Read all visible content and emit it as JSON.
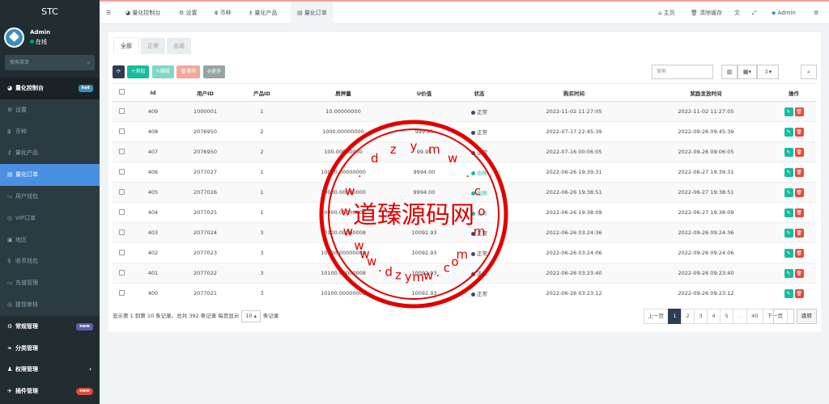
{
  "brand": "STC",
  "user": {
    "name": "Admin",
    "status": "在线"
  },
  "sidebar": {
    "search_placeholder": "搜索菜单",
    "items": [
      {
        "label": "量化控制台",
        "icon": "dashboard-icon",
        "badge": "hot",
        "kind": "head"
      },
      {
        "label": "设置",
        "icon": "gear-icon",
        "kind": "sub"
      },
      {
        "label": "币种",
        "icon": "bitcoin-icon",
        "kind": "sub"
      },
      {
        "label": "量化产品",
        "icon": "key-icon",
        "kind": "sub"
      },
      {
        "label": "量化订单",
        "icon": "book-icon",
        "kind": "active"
      },
      {
        "label": "用户钱包",
        "icon": "wallet-icon",
        "kind": "sub"
      },
      {
        "label": "VIP订单",
        "icon": "vip-icon",
        "kind": "sub"
      },
      {
        "label": "地区",
        "icon": "map-icon",
        "kind": "sub"
      },
      {
        "label": "收币钱包",
        "icon": "dollar-icon",
        "kind": "sub"
      },
      {
        "label": "充值管理",
        "icon": "card-icon",
        "kind": "sub"
      },
      {
        "label": "提现审核",
        "icon": "circle-icon",
        "kind": "sub"
      },
      {
        "label": "常规管理",
        "icon": "cogs-icon",
        "badge": "new",
        "kind": "grp"
      },
      {
        "label": "分类管理",
        "icon": "leaf-icon",
        "kind": "grp"
      },
      {
        "label": "权限管理",
        "icon": "group-icon",
        "chevron": "‹",
        "kind": "grp"
      },
      {
        "label": "插件管理",
        "icon": "rocket-icon",
        "badge": "new",
        "kind": "grp"
      }
    ]
  },
  "header": {
    "tabs": [
      "量化控制台",
      "设置",
      "币种",
      "量化产品",
      "量化订单"
    ],
    "right": {
      "home": "主页",
      "clear": "清除缓存",
      "admin": "Admin"
    }
  },
  "filter_tabs": [
    "全部",
    "正常",
    "出局"
  ],
  "toolbar": {
    "refresh": "⟳",
    "add": "添加",
    "edit": "编辑",
    "delete": "删除",
    "more": "更多"
  },
  "search_placeholder": "搜索",
  "columns": [
    "",
    "Id",
    "用户ID",
    "产品ID",
    "质押量",
    "U价值",
    "状态",
    "购买时间",
    "奖励发放时间",
    "操作"
  ],
  "rows": [
    {
      "id": "409",
      "uid": "1000001",
      "pid": "1",
      "amount": "10.00000000",
      "uvalue": "",
      "status": "正常",
      "buy": "2022-11-02 11:27:05",
      "reward": "2022-11-02 11:27:05"
    },
    {
      "id": "408",
      "uid": "2076950",
      "pid": "2",
      "amount": "1000.00000000",
      "uvalue": "999.95",
      "status": "正常",
      "buy": "2022-07-17 22:45:39",
      "reward": "2022-09-26 09:45:39"
    },
    {
      "id": "407",
      "uid": "2076950",
      "pid": "2",
      "amount": "100.00000000",
      "uvalue": "99.95",
      "status": "正常",
      "buy": "2022-07-16 00:06:05",
      "reward": "2022-09-26 09:06:05"
    },
    {
      "id": "406",
      "uid": "2077027",
      "pid": "1",
      "amount": "10000.00000000",
      "uvalue": "9994.00",
      "status": "出局",
      "buy": "2022-06-26 19:39:31",
      "reward": "2022-06-27 19:39:31"
    },
    {
      "id": "405",
      "uid": "2077026",
      "pid": "1",
      "amount": "10000.00000000",
      "uvalue": "9994.00",
      "status": "出局",
      "buy": "2022-06-26 19:38:51",
      "reward": "2022-06-27 19:38:51"
    },
    {
      "id": "404",
      "uid": "2077025",
      "pid": "1",
      "amount": "10000.00000000",
      "uvalue": "",
      "status": "出局",
      "buy": "2022-06-26 19:38:09",
      "reward": "2022-06-27 19:38:09"
    },
    {
      "id": "403",
      "uid": "2077024",
      "pid": "3",
      "amount": "10100.00000008",
      "uvalue": "10092.93",
      "status": "正常",
      "buy": "2022-06-26 03:24:36",
      "reward": "2022-09-26 09:24:36"
    },
    {
      "id": "402",
      "uid": "2077023",
      "pid": "3",
      "amount": "10100.00000008",
      "uvalue": "10092.93",
      "status": "正常",
      "buy": "2022-06-26 03:24:06",
      "reward": "2022-09-26 09:24:06"
    },
    {
      "id": "401",
      "uid": "2077022",
      "pid": "3",
      "amount": "10100.00000008",
      "uvalue": "10092.93",
      "status": "正常",
      "buy": "2022-06-26 03:23:40",
      "reward": "2022-09-26 09:23:40"
    },
    {
      "id": "400",
      "uid": "2077021",
      "pid": "3",
      "amount": "10100.00000008",
      "uvalue": "10092.93",
      "status": "正常",
      "buy": "2022-06-26 03:23:12",
      "reward": "2022-09-26 09:23:12"
    }
  ],
  "pagination": {
    "info_prefix": "显示第 1 到第 10 条记录，总共 392 条记录 每页显示",
    "page_size": "10",
    "info_suffix": "条记录",
    "prev": "上一页",
    "pages": [
      "1",
      "2",
      "3",
      "4",
      "5",
      "...",
      "40"
    ],
    "next": "下一页",
    "jump": "跳转"
  },
  "watermark": {
    "text": "道臻源码网",
    "url": "www.dzymw.com",
    "color": "#e00000"
  },
  "colors": {
    "sidebar": "#222d32",
    "active": "#4a90e2",
    "add": "#18bc9c",
    "delete": "#e74c3c"
  }
}
